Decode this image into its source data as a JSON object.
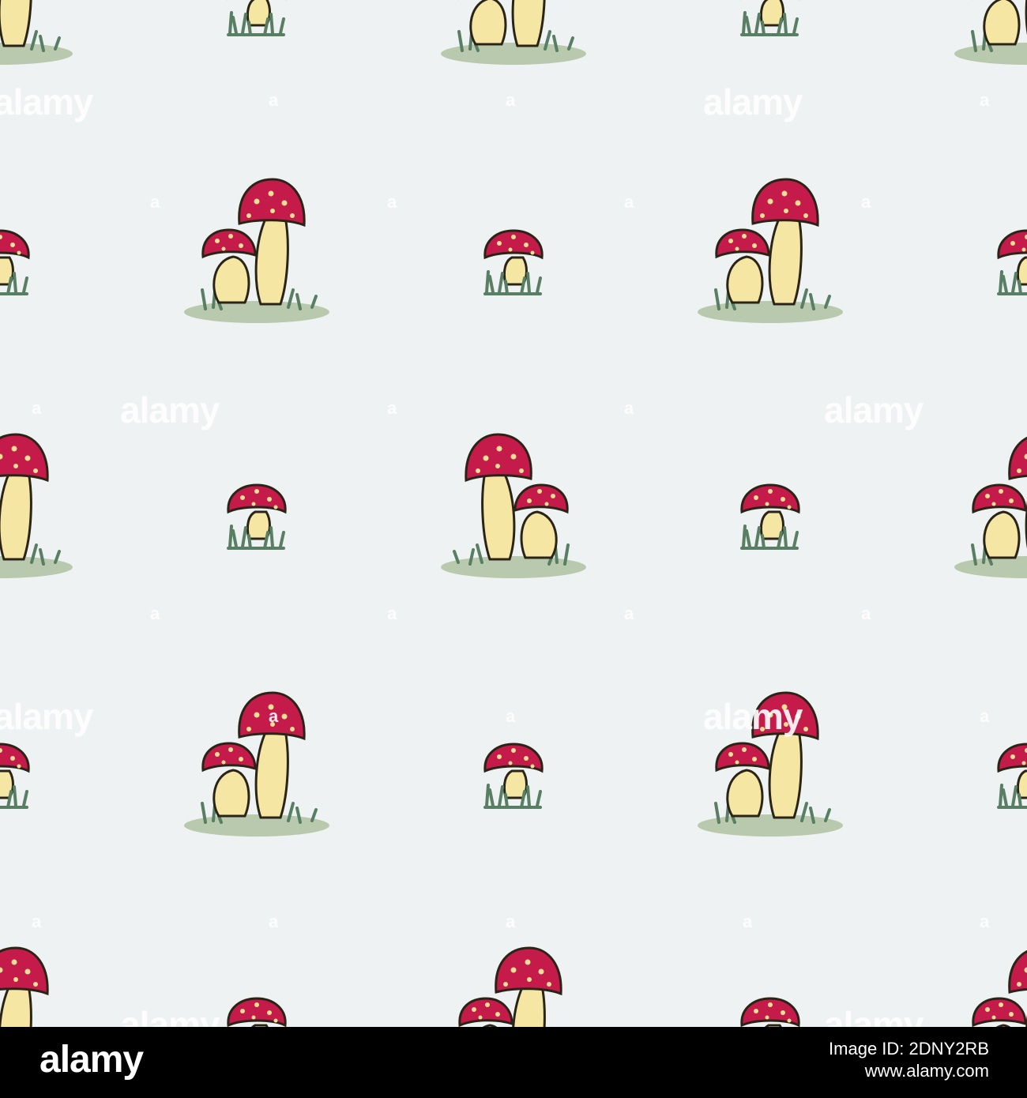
{
  "image": {
    "description_colors": {
      "background": "#eff2f2",
      "cap_red": "#c41b4b",
      "cap_spot": "#f3de93",
      "stem": "#f6e6a4",
      "outline": "#2a2417",
      "grass_dark": "#587e63",
      "grass_light": "#b9c9ad"
    }
  },
  "watermark": {
    "text": "alamy",
    "small_text": "a"
  },
  "footer": {
    "logo": "alamy",
    "image_id": "Image ID: 2DNY2RB",
    "site": "www.alamy.com"
  }
}
